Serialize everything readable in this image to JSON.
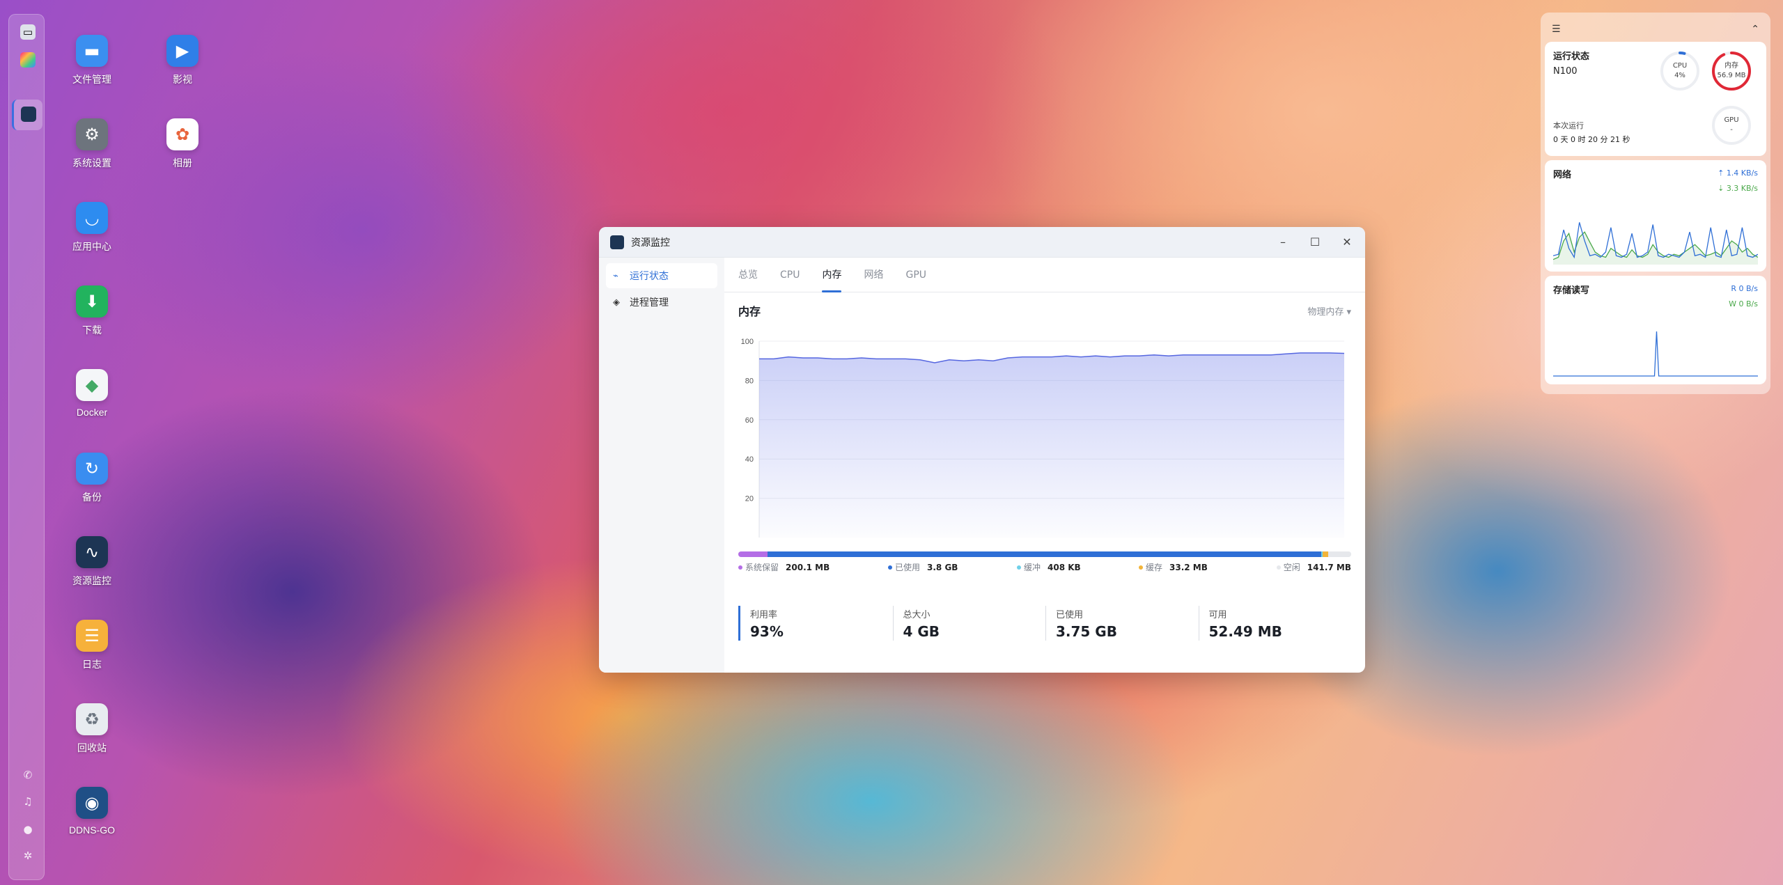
{
  "desktop": {
    "apps": [
      {
        "label": "文件管理",
        "icon": "folder-icon",
        "color": "#3b8ff0"
      },
      {
        "label": "影视",
        "icon": "film-icon",
        "color": "#2f7fe8"
      },
      {
        "label": "系统设置",
        "icon": "gear-icon",
        "color": "#6d747d"
      },
      {
        "label": "相册",
        "icon": "photos-icon",
        "color": "#ffffff"
      },
      {
        "label": "应用中心",
        "icon": "store-icon",
        "color": "#2d8cf0"
      },
      {
        "label": "下载",
        "icon": "download-icon",
        "color": "#22b35e"
      },
      {
        "label": "Docker",
        "icon": "docker-icon",
        "color": "#f4f6f8"
      },
      {
        "label": "备份",
        "icon": "backup-icon",
        "color": "#3a8df0"
      },
      {
        "label": "资源监控",
        "icon": "monitor-icon",
        "color": "#1d3554"
      },
      {
        "label": "日志",
        "icon": "log-icon",
        "color": "#f6b13b"
      },
      {
        "label": "回收站",
        "icon": "recycle-icon",
        "color": "#e8ecf0"
      },
      {
        "label": "DDNS-GO",
        "icon": "ddns-icon",
        "color": "#1f4f86"
      }
    ]
  },
  "window": {
    "title": "资源监控",
    "sidebar": [
      {
        "label": "运行状态",
        "icon": "chart-line-icon"
      },
      {
        "label": "进程管理",
        "icon": "layers-icon"
      }
    ],
    "tabs": [
      "总览",
      "CPU",
      "内存",
      "网络",
      "GPU"
    ],
    "active_tab": "内存",
    "section_title": "内存",
    "dropdown_label": "物理内存",
    "legend": [
      {
        "label": "系统保留",
        "value": "200.1 MB",
        "color": "#b46ee6"
      },
      {
        "label": "已使用",
        "value": "3.8 GB",
        "color": "#2f6fd6"
      },
      {
        "label": "缓冲",
        "value": "408 KB",
        "color": "#6fd0e8"
      },
      {
        "label": "缓存",
        "value": "33.2 MB",
        "color": "#f2b43a"
      },
      {
        "label": "空闲",
        "value": "141.7 MB",
        "color": "#e6e8ec"
      }
    ],
    "stats": [
      {
        "label": "利用率",
        "value": "93%"
      },
      {
        "label": "总大小",
        "value": "4 GB"
      },
      {
        "label": "已使用",
        "value": "3.75 GB"
      },
      {
        "label": "可用",
        "value": "52.49 MB"
      }
    ]
  },
  "chart_data": {
    "type": "area",
    "title": "内存",
    "y_ticks": [
      "100",
      "80",
      "60",
      "40",
      "20"
    ],
    "ylim": [
      0,
      100
    ],
    "grid": true,
    "x": [
      0,
      1,
      2,
      3,
      4,
      5,
      6,
      7,
      8,
      9,
      10,
      11,
      12,
      13,
      14,
      15,
      16,
      17,
      18,
      19,
      20,
      21,
      22,
      23,
      24,
      25,
      26,
      27,
      28,
      29,
      30,
      31,
      32,
      33,
      34,
      35,
      36,
      37,
      38,
      39,
      40
    ],
    "values": [
      91,
      91,
      92,
      91.5,
      91.5,
      91,
      91,
      91.5,
      91,
      91,
      91,
      90.5,
      89,
      90.5,
      90,
      90.5,
      90,
      91.5,
      92,
      92,
      92,
      92.5,
      92,
      92.5,
      92,
      92.5,
      92.5,
      93,
      92.5,
      93,
      93,
      93,
      93,
      93,
      93,
      93,
      93.5,
      94,
      94,
      94,
      93.8
    ],
    "color": "#5566e0"
  },
  "widget": {
    "status_title": "运行状态",
    "device": "N100",
    "cpu_label": "CPU",
    "cpu_value": "4%",
    "cpu_percent": 4,
    "mem_label": "内存",
    "mem_value": "56.9 MB",
    "mem_percent": 93,
    "gpu_label": "GPU",
    "gpu_value": "-",
    "uptime_label": "本次运行",
    "uptime_value": "0 天 0 时 20 分 21 秒",
    "network_title": "网络",
    "net_up": "1.4 KB/s",
    "net_down": "3.3 KB/s",
    "storage_title": "存储读写",
    "read_label": "R  0 B/s",
    "write_label": "W  0 B/s",
    "net_up_series": [
      10,
      12,
      45,
      20,
      8,
      55,
      30,
      10,
      12,
      8,
      15,
      48,
      10,
      8,
      12,
      40,
      8,
      10,
      15,
      52,
      10,
      8,
      12,
      10,
      8,
      15,
      42,
      10,
      12,
      8,
      48,
      10,
      8,
      45,
      10,
      12,
      48,
      10,
      8,
      12
    ],
    "net_down_series": [
      5,
      8,
      30,
      40,
      15,
      35,
      42,
      28,
      15,
      10,
      8,
      20,
      15,
      10,
      8,
      18,
      10,
      8,
      12,
      25,
      15,
      10,
      8,
      12,
      10,
      15,
      20,
      25,
      18,
      10,
      12,
      15,
      10,
      20,
      30,
      25,
      15,
      20,
      12,
      8
    ],
    "disk_series": [
      0,
      0,
      0,
      0,
      0,
      0,
      0,
      0,
      0,
      0,
      0,
      0,
      0,
      0,
      0,
      0,
      0,
      0,
      0,
      0,
      0,
      0,
      0,
      0,
      0,
      0,
      0,
      0,
      0,
      0,
      0,
      0,
      0,
      0,
      0,
      0,
      0,
      0,
      0,
      0,
      0,
      0,
      0,
      0,
      0,
      0,
      0,
      0,
      100,
      0,
      0,
      0,
      0,
      0,
      0,
      0,
      0,
      0,
      0,
      0,
      0,
      0,
      0,
      0,
      0,
      0,
      0,
      0,
      0,
      0,
      0,
      0,
      0,
      0,
      0,
      0,
      0,
      0,
      0,
      0,
      0,
      0,
      0,
      0,
      0,
      0,
      0,
      0,
      0,
      0,
      0,
      0,
      0,
      0,
      0,
      0
    ]
  }
}
